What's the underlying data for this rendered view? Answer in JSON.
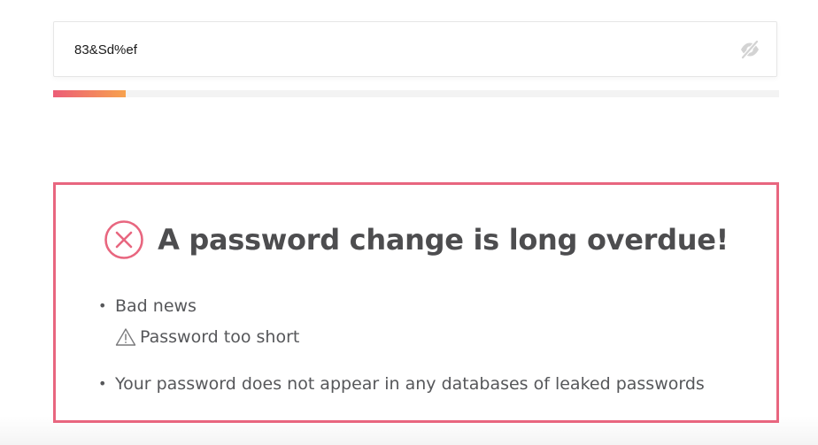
{
  "password_field": {
    "value": "83&Sd%ef",
    "toggle_icon": "eye-slash-icon"
  },
  "strength_meter": {
    "level_percent": 10,
    "colors": {
      "start": "#ec5d77",
      "end": "#f7a24e",
      "track": "#f3f3f3"
    }
  },
  "result": {
    "title": "A password change is long overdue!",
    "icon": "error-circle-icon",
    "accent_color": "#e8667f",
    "items": [
      {
        "label": "Bad news",
        "warning": {
          "icon": "warning-triangle-icon",
          "text": "Password too short"
        }
      },
      {
        "label": "Your password does not appear in any databases of leaked passwords"
      }
    ]
  }
}
